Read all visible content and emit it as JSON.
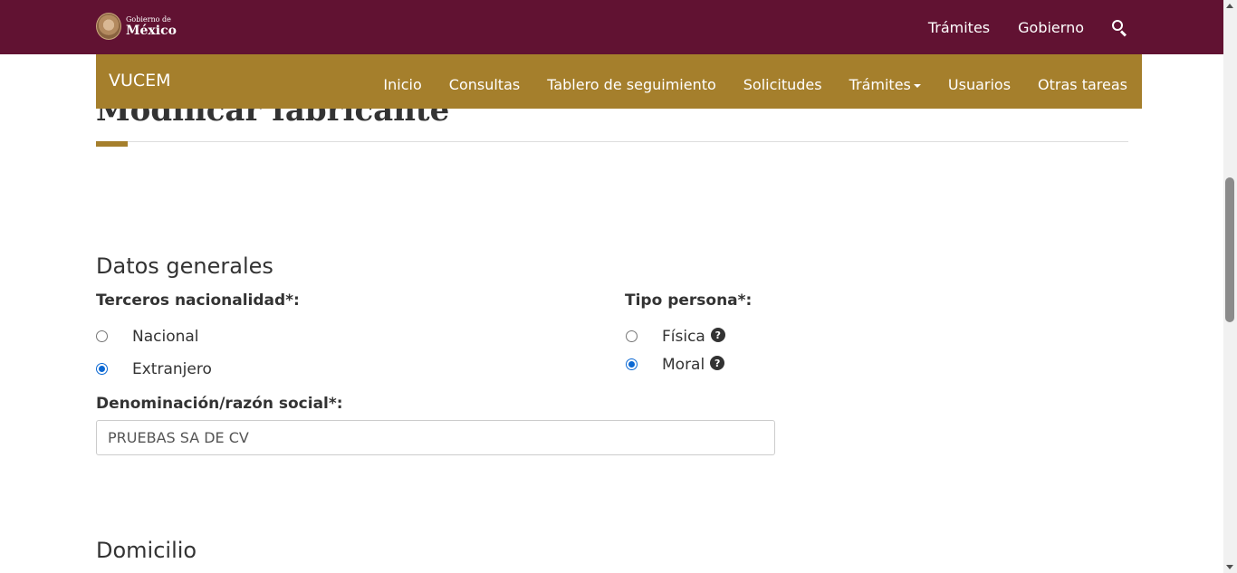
{
  "header": {
    "logo_small": "Gobierno de",
    "logo_big": "México",
    "links": [
      "Trámites",
      "Gobierno"
    ]
  },
  "subnav": {
    "brand": "VUCEM",
    "items": [
      "Inicio",
      "Consultas",
      "Tablero de seguimiento",
      "Solicitudes",
      "Trámites",
      "Usuarios",
      "Otras tareas"
    ]
  },
  "page": {
    "title": "Modificar fabricante"
  },
  "datos_generales": {
    "heading": "Datos generales",
    "nacionalidad_label": "Terceros nacionalidad*:",
    "nacionalidad_options": [
      "Nacional",
      "Extranjero"
    ],
    "nacionalidad_selected": "Extranjero",
    "tipo_persona_label": "Tipo persona*:",
    "tipo_persona_options": [
      "Física",
      "Moral"
    ],
    "tipo_persona_selected": "Moral",
    "denominacion_label": "Denominación/razón social*:",
    "denominacion_value": "PRUEBAS SA DE CV"
  },
  "domicilio": {
    "heading": "Domicilio"
  },
  "colors": {
    "header_bg": "#611232",
    "subnav_bg": "#a57f2c",
    "radio_checked": "#0b68d3"
  }
}
